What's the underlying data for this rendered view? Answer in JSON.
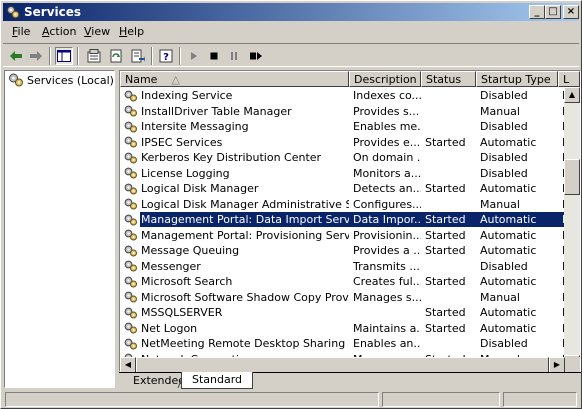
{
  "window": {
    "title": "Services",
    "minimize_label": "_",
    "maximize_label": "□",
    "close_label": "×"
  },
  "menu": [
    {
      "label": "File",
      "key": "F",
      "rest": "ile"
    },
    {
      "label": "Action",
      "key": "A",
      "rest": "ction"
    },
    {
      "label": "View",
      "key": "V",
      "rest": "iew"
    },
    {
      "label": "Help",
      "key": "H",
      "rest": "elp"
    }
  ],
  "tree": {
    "root_label": "Services (Local)"
  },
  "columns": [
    "Name",
    "Description",
    "Status",
    "Startup Type",
    "L"
  ],
  "rows": [
    {
      "name": "Indexing Service",
      "description": "Indexes co...",
      "status": "",
      "startup": "Disabled",
      "logon": "L"
    },
    {
      "name": "InstallDriver Table Manager",
      "description": "Provides s...",
      "status": "",
      "startup": "Manual",
      "logon": "L"
    },
    {
      "name": "Intersite Messaging",
      "description": "Enables me...",
      "status": "",
      "startup": "Disabled",
      "logon": "L"
    },
    {
      "name": "IPSEC Services",
      "description": "Provides e...",
      "status": "Started",
      "startup": "Automatic",
      "logon": "L"
    },
    {
      "name": "Kerberos Key Distribution Center",
      "description": "On domain ...",
      "status": "",
      "startup": "Disabled",
      "logon": "L"
    },
    {
      "name": "License Logging",
      "description": "Monitors a...",
      "status": "",
      "startup": "Disabled",
      "logon": "N"
    },
    {
      "name": "Logical Disk Manager",
      "description": "Detects an...",
      "status": "Started",
      "startup": "Automatic",
      "logon": "L"
    },
    {
      "name": "Logical Disk Manager Administrative Service",
      "description": "Configures...",
      "status": "",
      "startup": "Manual",
      "logon": "L"
    },
    {
      "name": "Management Portal: Data Import Server",
      "description": "Data Impor...",
      "status": "Started",
      "startup": "Automatic",
      "logon": "L",
      "selected": true
    },
    {
      "name": "Management Portal: Provisioning Server",
      "description": "Provisionin...",
      "status": "Started",
      "startup": "Automatic",
      "logon": "L"
    },
    {
      "name": "Message Queuing",
      "description": "Provides a ...",
      "status": "Started",
      "startup": "Automatic",
      "logon": "L"
    },
    {
      "name": "Messenger",
      "description": "Transmits ...",
      "status": "",
      "startup": "Disabled",
      "logon": "L"
    },
    {
      "name": "Microsoft Search",
      "description": "Creates ful...",
      "status": "Started",
      "startup": "Automatic",
      "logon": "L"
    },
    {
      "name": "Microsoft Software Shadow Copy Provider",
      "description": "Manages s...",
      "status": "",
      "startup": "Manual",
      "logon": "L"
    },
    {
      "name": "MSSQLSERVER",
      "description": "",
      "status": "Started",
      "startup": "Automatic",
      "logon": "L"
    },
    {
      "name": "Net Logon",
      "description": "Maintains a...",
      "status": "Started",
      "startup": "Automatic",
      "logon": "L"
    },
    {
      "name": "NetMeeting Remote Desktop Sharing",
      "description": "Enables an...",
      "status": "",
      "startup": "Disabled",
      "logon": "L"
    },
    {
      "name": "Network Connections",
      "description": "Manages o...",
      "status": "Started",
      "startup": "Manual",
      "logon": "L"
    }
  ],
  "tabs": [
    {
      "label": "Extended",
      "active": false
    },
    {
      "label": "Standard",
      "active": true
    }
  ]
}
